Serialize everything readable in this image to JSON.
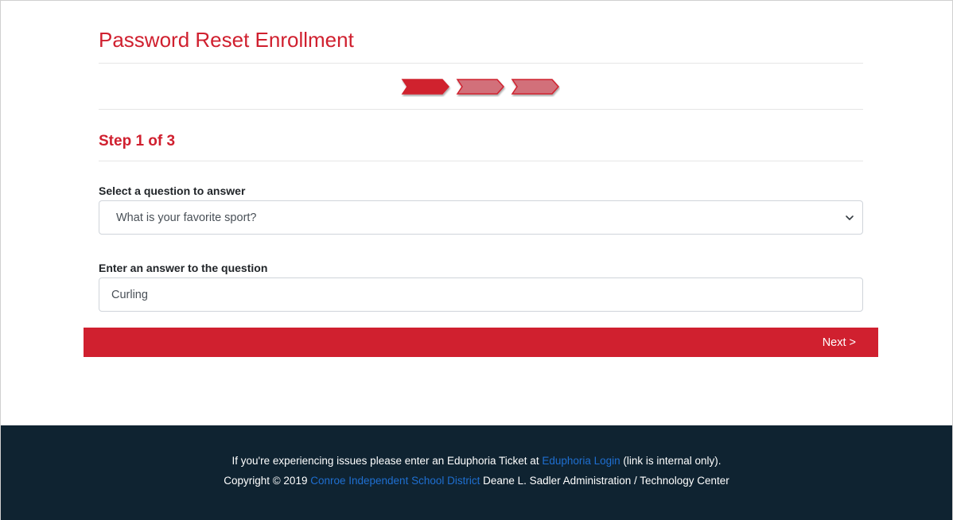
{
  "header": {
    "title": "Password Reset Enrollment"
  },
  "progress": {
    "current_step": 1,
    "total_steps": 3,
    "active_color": "#d0202f",
    "inactive_color": "#d2707a",
    "step_label": "Step 1 of 3"
  },
  "form": {
    "question_label": "Select a question to answer",
    "question_selected": "What is your favorite sport?",
    "answer_label": "Enter an answer to the question",
    "answer_value": "Curling",
    "next_label": "Next >"
  },
  "footer": {
    "line1_prefix": "If you're experiencing issues please enter an Eduphoria Ticket at ",
    "line1_link": "Eduphoria Login",
    "line1_suffix": " (link is internal only).",
    "line2_prefix": "Copyright © 2019 ",
    "line2_link": "Conroe Independent School District",
    "line2_suffix": " Deane L. Sadler Administration / Technology Center"
  },
  "colors": {
    "brand_red": "#d0202f",
    "footer_bg": "#0f2331",
    "link_blue": "#1f6fd1"
  }
}
